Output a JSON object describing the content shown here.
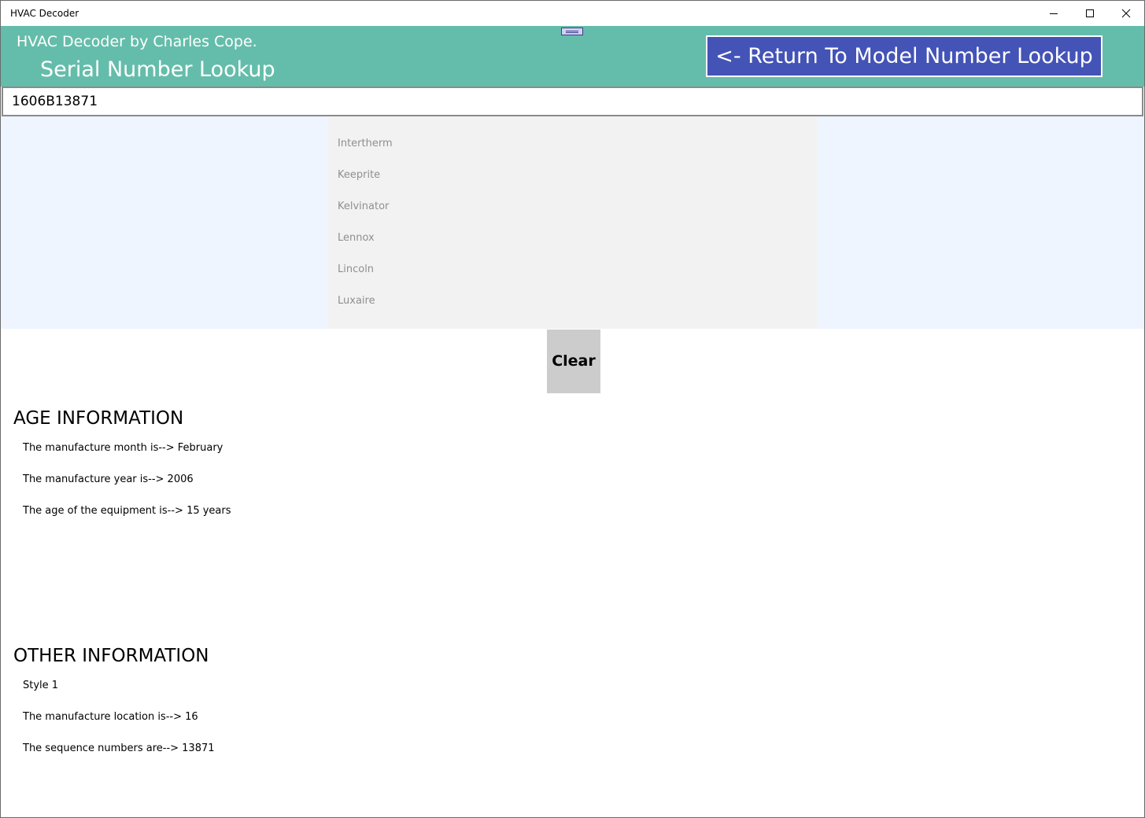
{
  "window": {
    "title": "HVAC Decoder"
  },
  "header": {
    "brand": "HVAC Decoder by Charles Cope.",
    "page_title": "Serial Number Lookup",
    "return_button": "<- Return To Model Number Lookup",
    "background_color": "#64bdaa",
    "button_color": "#4453b6"
  },
  "serial_input": {
    "value": "1606B13871"
  },
  "manufacturers": {
    "items": [
      "Intertherm",
      "Keeprite",
      "Kelvinator",
      "Lennox",
      "Lincoln",
      "Luxaire"
    ]
  },
  "clear_button": {
    "label": "Clear"
  },
  "age_info": {
    "heading": "AGE INFORMATION",
    "lines": [
      "The manufacture month is--> February",
      "The manufacture year is--> 2006",
      "The age of the equipment is--> 15 years"
    ]
  },
  "other_info": {
    "heading": "OTHER INFORMATION",
    "lines": [
      "Style 1",
      "The manufacture location is--> 16",
      "The sequence numbers are--> 13871"
    ]
  }
}
